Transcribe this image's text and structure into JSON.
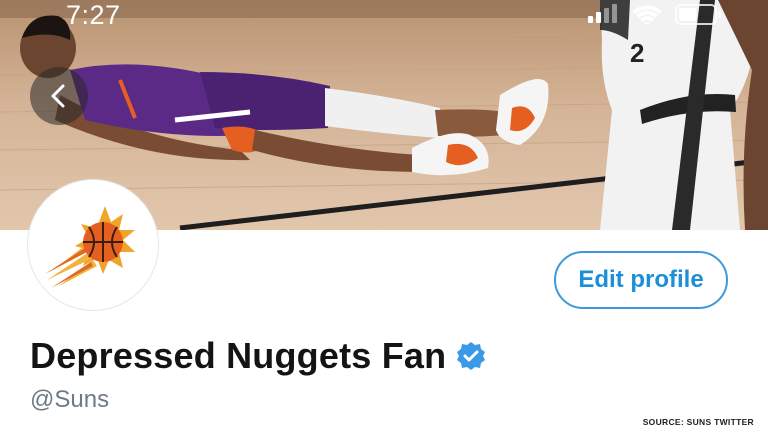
{
  "status_bar": {
    "time": "7:27"
  },
  "profile": {
    "display_name": "Depressed Nuggets Fan",
    "handle": "@Suns",
    "verified": true,
    "edit_profile_label": "Edit profile"
  },
  "banner": {
    "jersey_number": "2"
  },
  "source_credit": "SOURCE: SUNS TWITTER",
  "colors": {
    "accent": "#1d8fd8",
    "suns_purple": "#5b2a86",
    "suns_orange": "#e56020",
    "court": "#c9a27a"
  }
}
